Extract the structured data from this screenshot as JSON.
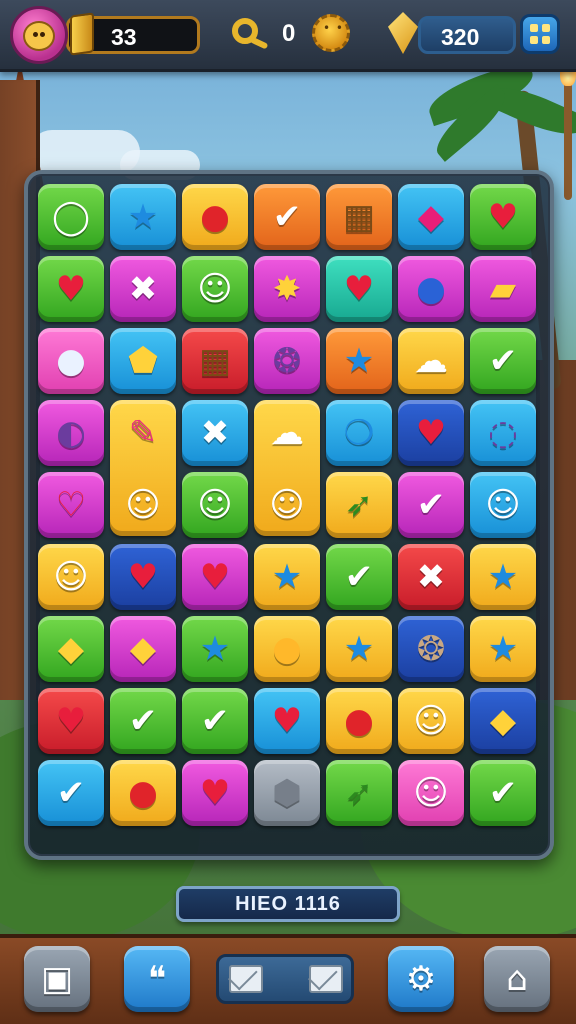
{
  "hud": {
    "lives_value": "33",
    "keys_value": "0",
    "gems_value": "320",
    "icons": {
      "avatar": "player-avatar-icon",
      "gold_bar": "gold-bar-icon",
      "key": "key-icon",
      "sun": "sun-token-icon",
      "gem": "gold-gem-icon",
      "menu": "grid-menu-icon"
    }
  },
  "board": {
    "rows": 9,
    "cols": 7,
    "cells": [
      [
        {
          "color": "green",
          "icon": "ring",
          "glyph": "◯"
        },
        {
          "color": "blue",
          "icon": "star",
          "glyph": "★"
        },
        {
          "color": "yellow",
          "icon": "red-blob",
          "glyph": "●"
        },
        {
          "color": "orange",
          "icon": "check",
          "glyph": "✔"
        },
        {
          "color": "orange",
          "icon": "crate",
          "glyph": "▦"
        },
        {
          "color": "blue",
          "icon": "diamond",
          "glyph": "◆"
        },
        {
          "color": "green",
          "icon": "heart",
          "glyph": "♥"
        }
      ],
      [
        {
          "color": "green",
          "icon": "heart",
          "glyph": "♥"
        },
        {
          "color": "magenta",
          "icon": "cross",
          "glyph": "✖"
        },
        {
          "color": "green",
          "icon": "face",
          "glyph": "☺"
        },
        {
          "color": "magenta",
          "icon": "burst",
          "glyph": "✸"
        },
        {
          "color": "teal",
          "icon": "heart",
          "glyph": "♥"
        },
        {
          "color": "magenta",
          "icon": "potion",
          "glyph": "●"
        },
        {
          "color": "magenta",
          "icon": "bar",
          "glyph": "▰"
        }
      ],
      [
        {
          "color": "pink",
          "icon": "orb",
          "glyph": "●"
        },
        {
          "color": "blue",
          "icon": "gem",
          "glyph": "⬟"
        },
        {
          "color": "red",
          "icon": "crate",
          "glyph": "▦"
        },
        {
          "color": "magenta",
          "icon": "swirl",
          "glyph": "❂"
        },
        {
          "color": "orange",
          "icon": "star",
          "glyph": "★"
        },
        {
          "color": "yellow",
          "icon": "cloud",
          "glyph": "☁"
        },
        {
          "color": "green",
          "icon": "check-coin",
          "glyph": "✔"
        }
      ],
      [
        {
          "color": "magenta",
          "icon": "swirl",
          "glyph": "◐"
        },
        {
          "color": "tall-yellow",
          "icon": "lipstick",
          "glyph": "✎"
        },
        {
          "color": "blue",
          "icon": "cross",
          "glyph": "✖"
        },
        {
          "color": "tall-yellow",
          "icon": "cloud",
          "glyph": "☁"
        },
        {
          "color": "blue",
          "icon": "drop",
          "glyph": "❍"
        },
        {
          "color": "navy",
          "icon": "heart",
          "glyph": "♥"
        },
        {
          "color": "blue",
          "icon": "swirl",
          "glyph": "◌"
        }
      ],
      [
        {
          "color": "magenta",
          "icon": "heart",
          "glyph": "♡"
        },
        {
          "color": "tall-yellow",
          "icon": "face",
          "glyph": "☺"
        },
        {
          "color": "green",
          "icon": "face",
          "glyph": "☺"
        },
        {
          "color": "tall-yellow",
          "icon": "face",
          "glyph": "☺"
        },
        {
          "color": "yellow",
          "icon": "arrow",
          "glyph": "➶"
        },
        {
          "color": "magenta",
          "icon": "check",
          "glyph": "✔"
        },
        {
          "color": "blue",
          "icon": "face",
          "glyph": "☺"
        }
      ],
      [
        {
          "color": "yellow",
          "icon": "face",
          "glyph": "☺"
        },
        {
          "color": "navy",
          "icon": "heart",
          "glyph": "♥"
        },
        {
          "color": "magenta",
          "icon": "heart",
          "glyph": "♥"
        },
        {
          "color": "yellow",
          "icon": "star",
          "glyph": "★"
        },
        {
          "color": "green",
          "icon": "check",
          "glyph": "✔"
        },
        {
          "color": "red",
          "icon": "cross",
          "glyph": "✖"
        },
        {
          "color": "yellow",
          "icon": "star",
          "glyph": "★"
        }
      ],
      [
        {
          "color": "green",
          "icon": "gem",
          "glyph": "◆"
        },
        {
          "color": "magenta",
          "icon": "gem",
          "glyph": "◆"
        },
        {
          "color": "green",
          "icon": "star",
          "glyph": "★"
        },
        {
          "color": "yellow",
          "icon": "bubble",
          "glyph": "●"
        },
        {
          "color": "yellow",
          "icon": "star",
          "glyph": "★"
        },
        {
          "color": "navy",
          "icon": "shell",
          "glyph": "❂"
        },
        {
          "color": "yellow",
          "icon": "star",
          "glyph": "★"
        }
      ],
      [
        {
          "color": "red",
          "icon": "heart",
          "glyph": "♥"
        },
        {
          "color": "green",
          "icon": "check",
          "glyph": "✔"
        },
        {
          "color": "green",
          "icon": "check-coin",
          "glyph": "✔"
        },
        {
          "color": "blue",
          "icon": "heart",
          "glyph": "♥"
        },
        {
          "color": "yellow",
          "icon": "dot",
          "glyph": "●"
        },
        {
          "color": "yellow",
          "icon": "face",
          "glyph": "☺"
        },
        {
          "color": "navy",
          "icon": "gem",
          "glyph": "◆"
        }
      ],
      [
        {
          "color": "blue",
          "icon": "check-coin",
          "glyph": "✔"
        },
        {
          "color": "yellow",
          "icon": "dot",
          "glyph": "●"
        },
        {
          "color": "magenta",
          "icon": "heart",
          "glyph": "♥"
        },
        {
          "color": "gray",
          "icon": "nut",
          "glyph": "⬢"
        },
        {
          "color": "green",
          "icon": "arrow",
          "glyph": "➶"
        },
        {
          "color": "pink",
          "icon": "face",
          "glyph": "☺"
        },
        {
          "color": "green",
          "icon": "check-coin",
          "glyph": "✔"
        }
      ]
    ]
  },
  "level_label": "HIEO 1116",
  "bottom_bar": {
    "buttons": [
      {
        "name": "map-button",
        "icon": "map-icon",
        "glyph": "▣"
      },
      {
        "name": "chat-button",
        "icon": "speech-bubble-icon",
        "glyph": "❝"
      },
      {
        "name": "settings-button",
        "icon": "gear-icon",
        "glyph": "⚙"
      },
      {
        "name": "home-button",
        "icon": "home-icon",
        "glyph": "⌂"
      }
    ],
    "mail_icons": [
      "envelope-icon",
      "envelope-icon"
    ]
  },
  "colors": {
    "hud_bg": "#2e3847",
    "board_border": "#5f7384",
    "bottom_bar": "#7a3f1f",
    "level_bar": "#1f3d66"
  }
}
